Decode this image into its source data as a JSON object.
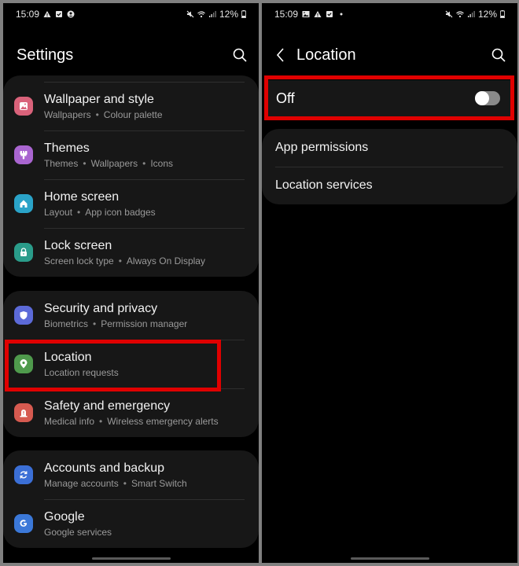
{
  "left_screen": {
    "status_bar": {
      "time": "15:09",
      "left_icons": [
        "warning-icon",
        "checkbox-notification-icon",
        "account-icon"
      ],
      "right_icons": [
        "mute-icon",
        "wifi-icon",
        "signal-icon"
      ],
      "battery": "12%"
    },
    "header": {
      "title": "Settings",
      "search_icon": "search-icon"
    },
    "groups": [
      {
        "items": [
          {
            "title": "Wallpaper and style",
            "subs": [
              "Wallpapers",
              "Colour palette"
            ],
            "icon": "wallpaper-icon",
            "color": "#d9627a"
          },
          {
            "title": "Themes",
            "subs": [
              "Themes",
              "Wallpapers",
              "Icons"
            ],
            "icon": "brush-icon",
            "color": "#a965d0"
          },
          {
            "title": "Home screen",
            "subs": [
              "Layout",
              "App icon badges"
            ],
            "icon": "home-icon",
            "color": "#2aa3c8"
          },
          {
            "title": "Lock screen",
            "subs": [
              "Screen lock type",
              "Always On Display"
            ],
            "icon": "lock-icon",
            "color": "#2a9c8a"
          }
        ]
      },
      {
        "items": [
          {
            "title": "Security and privacy",
            "subs": [
              "Biometrics",
              "Permission manager"
            ],
            "icon": "shield-icon",
            "color": "#5c6ad8"
          },
          {
            "title": "Location",
            "subs": [
              "Location requests"
            ],
            "icon": "location-pin-icon",
            "color": "#4f9a4c",
            "highlighted": true
          },
          {
            "title": "Safety and emergency",
            "subs": [
              "Medical info",
              "Wireless emergency alerts"
            ],
            "icon": "emergency-icon",
            "color": "#d65a50"
          }
        ]
      },
      {
        "items": [
          {
            "title": "Accounts and backup",
            "subs": [
              "Manage accounts",
              "Smart Switch"
            ],
            "icon": "sync-icon",
            "color": "#3b6fd6"
          },
          {
            "title": "Google",
            "subs": [
              "Google services"
            ],
            "icon": "google-icon",
            "color": "#3b78d8"
          }
        ]
      }
    ]
  },
  "right_screen": {
    "status_bar": {
      "time": "15:09",
      "left_icons": [
        "image-icon",
        "warning-icon",
        "checkbox-notification-icon",
        "dot-icon"
      ],
      "right_icons": [
        "mute-icon",
        "wifi-icon",
        "signal-icon"
      ],
      "battery": "12%"
    },
    "header": {
      "title": "Location",
      "back_icon": "back-chevron-icon",
      "search_icon": "search-icon"
    },
    "master_toggle": {
      "label": "Off",
      "state": "off",
      "highlighted": true
    },
    "items": [
      {
        "title": "App permissions"
      },
      {
        "title": "Location services"
      }
    ]
  },
  "colors": {
    "highlight": "#e00000",
    "card_bg": "#171717",
    "screen_bg": "#000000"
  }
}
